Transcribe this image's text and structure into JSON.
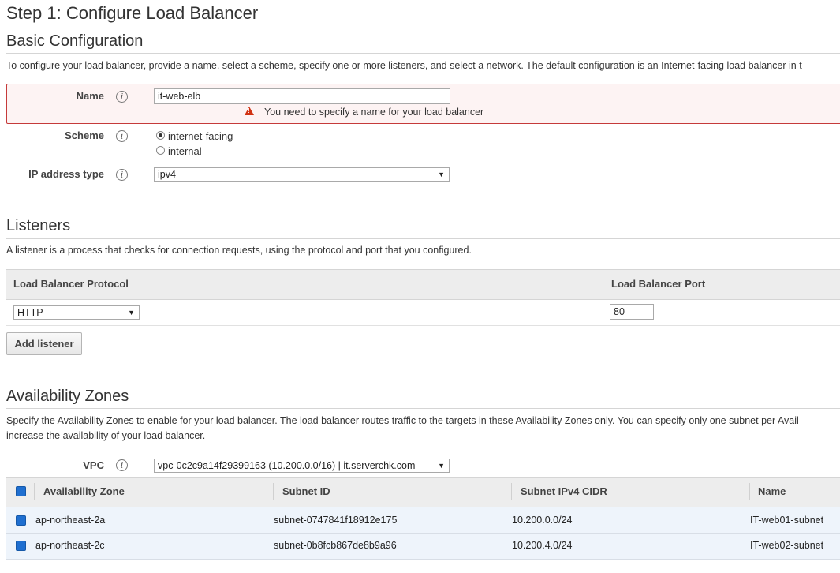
{
  "page_title": "Step 1: Configure Load Balancer",
  "basic": {
    "heading": "Basic Configuration",
    "description": "To configure your load balancer, provide a name, select a scheme, specify one or more listeners, and select a network. The default configuration is an Internet-facing load balancer in t",
    "name_label": "Name",
    "name_value": "it-web-elb",
    "name_error": "You need to specify a name for your load balancer",
    "scheme_label": "Scheme",
    "scheme_options": [
      "internet-facing",
      "internal"
    ],
    "scheme_selected": "internet-facing",
    "ip_label": "IP address type",
    "ip_value": "ipv4"
  },
  "listeners": {
    "heading": "Listeners",
    "description": "A listener is a process that checks for connection requests, using the protocol and port that you configured.",
    "col_protocol": "Load Balancer Protocol",
    "col_port": "Load Balancer Port",
    "protocol_value": "HTTP",
    "port_value": "80",
    "add_button": "Add listener"
  },
  "az": {
    "heading": "Availability Zones",
    "description_line1": "Specify the Availability Zones to enable for your load balancer. The load balancer routes traffic to the targets in these Availability Zones only. You can specify only one subnet per Avail",
    "description_line2": "increase the availability of your load balancer.",
    "vpc_label": "VPC",
    "vpc_value": "vpc-0c2c9a14f29399163 (10.200.0.0/16) | it.serverchk.com",
    "columns": [
      "Availability Zone",
      "Subnet ID",
      "Subnet IPv4 CIDR",
      "Name"
    ],
    "rows": [
      {
        "zone": "ap-northeast-2a",
        "subnet": "subnet-0747841f18912e175",
        "cidr": "10.200.0.0/24",
        "name": "IT-web01-subnet"
      },
      {
        "zone": "ap-northeast-2c",
        "subnet": "subnet-0b8fcb867de8b9a96",
        "cidr": "10.200.4.0/24",
        "name": "IT-web02-subnet"
      }
    ]
  },
  "icons": {
    "info": "info-icon",
    "warning": "warning-icon",
    "caret": "chevron-down-icon"
  },
  "colors": {
    "error_border": "#c53a3a",
    "error_bg": "#fdf3f3",
    "checkbox": "#1f6fd0",
    "warning": "#d13212"
  }
}
